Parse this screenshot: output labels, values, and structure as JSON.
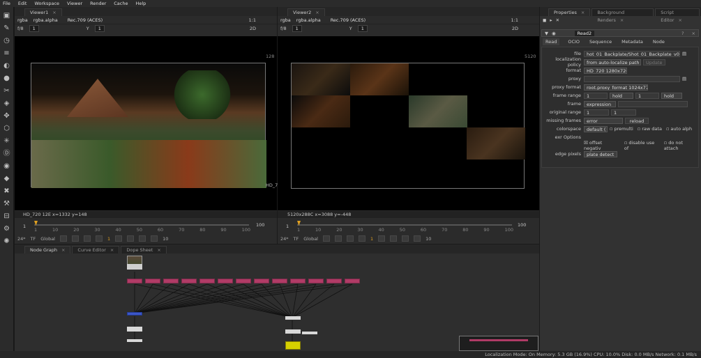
{
  "menu": [
    "File",
    "Edit",
    "Workspace",
    "Viewer",
    "Render",
    "Cache",
    "Help"
  ],
  "viewer1": {
    "tab": "Viewer1",
    "channels": "rgba",
    "alpha": "rgba.alpha",
    "colorspace": "Rec.709 (ACES)",
    "fstop": "f/8",
    "frame_field": "1",
    "y_field": "Y",
    "y_value": "1",
    "zoom": "1:1",
    "mode": "2D",
    "res_label": "HD_7",
    "res_top": "128",
    "status": "HD_720 12E  x=1332 y=148",
    "range_start": "1",
    "range_end": "100",
    "ticks": [
      "1",
      "10",
      "20",
      "30",
      "40",
      "50",
      "60",
      "70",
      "80",
      "90",
      "100"
    ],
    "fps": "24*",
    "tf": "TF",
    "global": "Global",
    "current_frame": "1",
    "inc": "10"
  },
  "viewer2": {
    "tab": "Viewer2",
    "channels": "rgba",
    "alpha": "rgba.alpha",
    "colorspace": "Rec.709 (ACES)",
    "fstop": "f/8",
    "frame_field": "1",
    "y_field": "Y",
    "y_value": "1",
    "zoom": "1:1",
    "mode": "2D",
    "res_top": "5120",
    "status": "5120x288C  x=3088 y=-448",
    "range_start": "1",
    "range_end": "100",
    "ticks": [
      "1",
      "10",
      "20",
      "30",
      "40",
      "50",
      "60",
      "70",
      "80",
      "90",
      "100"
    ],
    "fps": "24*",
    "tf": "TF",
    "global": "Global",
    "current_frame": "1",
    "inc": "10"
  },
  "bottom_tabs": [
    "Node Graph",
    "Curve Editor",
    "Dope Sheet"
  ],
  "properties": {
    "tabs": [
      "Properties",
      "Background Renders",
      "Script Editor"
    ],
    "node_name": "Read2",
    "node_tabs": [
      "Read",
      "OCIO",
      "Sequence",
      "Metadata",
      "Node"
    ],
    "file_label": "file",
    "file_value": "hot_01_Backplate/Shot_01_Backplate_v05.exr",
    "localization_label": "localization policy",
    "localization_value": "from auto-localize path",
    "update_label": "Update",
    "format_label": "format",
    "format_value": "HD_720 1280x720",
    "proxy_label": "proxy",
    "proxy_format_label": "proxy format",
    "proxy_format_value": "root.proxy_format 1024x778",
    "frame_range_label": "frame range",
    "frame_range_start": "1",
    "frame_range_mode1": "hold",
    "frame_range_end": "1",
    "frame_range_mode2": "hold",
    "frame_label": "frame",
    "frame_value": "expression",
    "original_range_label": "original range",
    "original_range_start": "1",
    "original_range_end": "1",
    "missing_frames_label": "missing frames",
    "missing_frames_value": "error",
    "reload_label": "reload",
    "colorspace_label": "colorspace",
    "colorspace_value": "default (",
    "premultiplied": "premulti",
    "raw_data": "raw data",
    "auto_alpha": "auto alph",
    "exr_options": "exr Options",
    "offset_negative": "offset negativ",
    "disable_use_of": "disable use of",
    "do_not_attach": "do not attach",
    "edge_pixels_label": "edge pixels",
    "edge_pixels_value": "plate detect"
  },
  "status_bar": "Localization Mode: On Memory: 5.3 GB (16.9%) CPU: 10.0% Disk: 0.0 MB/s Network: 0.1 MB/s",
  "colors": {
    "node_pink": "#b03b66",
    "node_blue": "#3c56c8",
    "node_yellow": "#d6d000",
    "panel_bg": "#2b2b2b"
  },
  "icons": [
    "viewer-icon",
    "paint-icon",
    "clock-icon",
    "channel-icon",
    "color-icon",
    "filter-icon",
    "keyer-icon",
    "merge-icon",
    "transform-icon",
    "3d-icon",
    "particles-icon",
    "deep-icon",
    "views-icon",
    "metadata-icon",
    "toolsets-icon",
    "other-icon",
    "furnace-icon",
    "cara-icon",
    "ocio-icon"
  ]
}
